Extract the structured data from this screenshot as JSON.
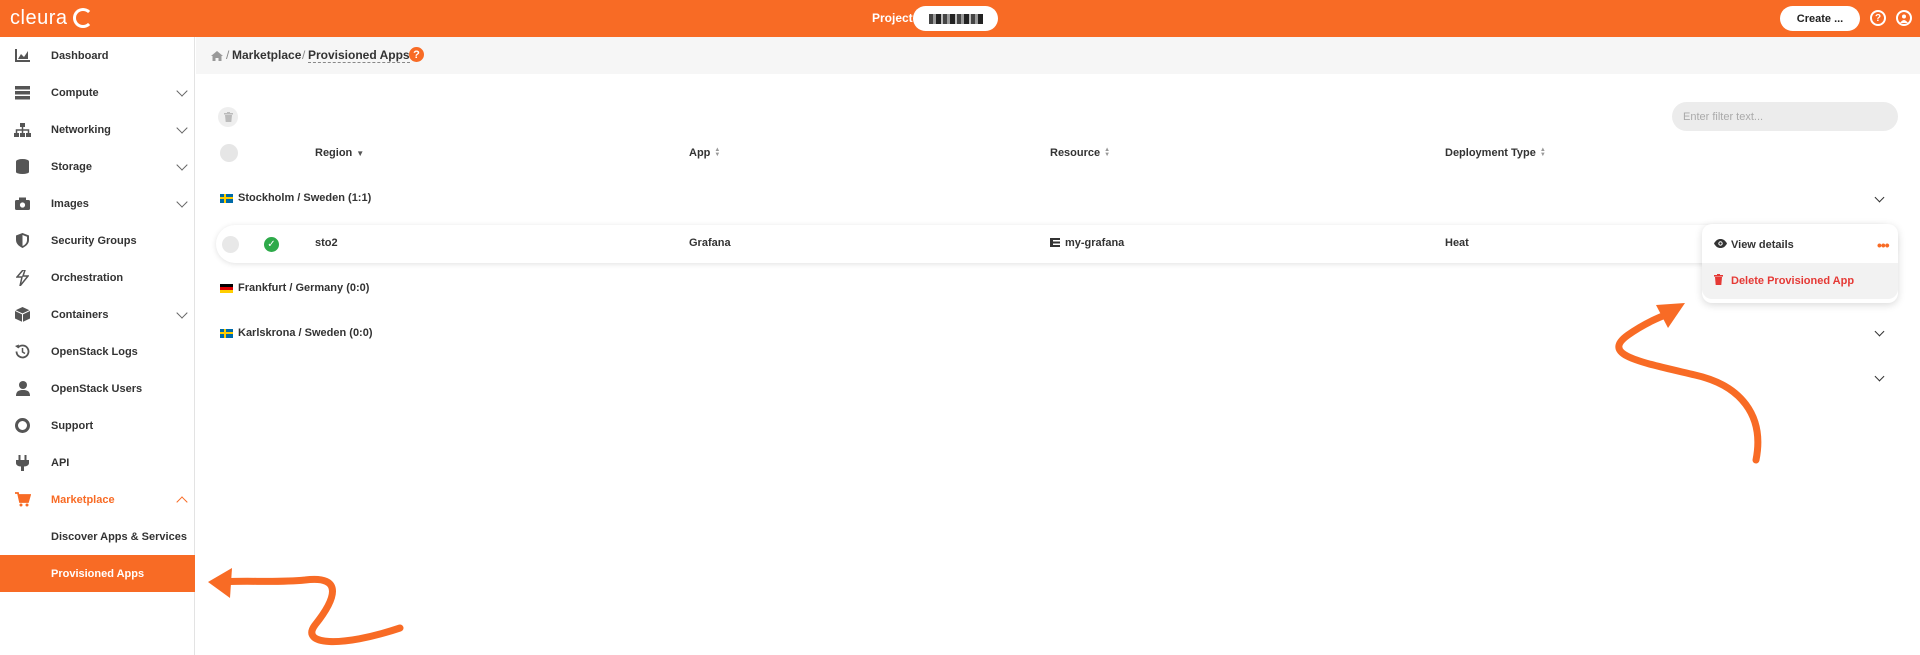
{
  "brand": {
    "name": "cleura"
  },
  "topbar": {
    "project_label": "Project",
    "create_label": "Create ...",
    "help_icon": "?"
  },
  "sidebar": {
    "items": [
      {
        "label": "Dashboard",
        "icon": "chart-icon"
      },
      {
        "label": "Compute",
        "icon": "server-icon"
      },
      {
        "label": "Networking",
        "icon": "network-icon"
      },
      {
        "label": "Storage",
        "icon": "database-icon"
      },
      {
        "label": "Images",
        "icon": "camera-icon"
      },
      {
        "label": "Security Groups",
        "icon": "shield-icon"
      },
      {
        "label": "Orchestration",
        "icon": "orchestration-icon"
      },
      {
        "label": "Containers",
        "icon": "cube-icon"
      },
      {
        "label": "OpenStack Logs",
        "icon": "history-icon"
      },
      {
        "label": "OpenStack Users",
        "icon": "user-icon"
      },
      {
        "label": "Support",
        "icon": "lifebuoy-icon"
      },
      {
        "label": "API",
        "icon": "plug-icon"
      },
      {
        "label": "Marketplace",
        "icon": "cart-icon"
      },
      {
        "label": "Discover Apps & Services"
      },
      {
        "label": "Provisioned Apps"
      }
    ]
  },
  "breadcrumb": {
    "sep": "/",
    "marketplace": "Marketplace",
    "current": "Provisioned Apps",
    "help": "?"
  },
  "filter": {
    "placeholder": "Enter filter text..."
  },
  "table": {
    "columns": {
      "region": "Region",
      "app": "App",
      "resource": "Resource",
      "deployment": "Deployment Type"
    },
    "groups": [
      {
        "label": "Stockholm / Sweden",
        "count": "(1:1)"
      },
      {
        "label": "Frankfurt / Germany",
        "count": "(0:0)"
      },
      {
        "label": "Karlskrona / Sweden",
        "count": "(0:0)"
      }
    ],
    "rows": [
      {
        "region": "sto2",
        "app": "Grafana",
        "resource": "my-grafana",
        "deployment": "Heat",
        "status": "✓"
      }
    ]
  },
  "menu": {
    "view_details": "View details",
    "delete": "Delete Provisioned App",
    "more": "•••"
  },
  "colors": {
    "accent": "#f86b25",
    "danger": "#e53935",
    "success": "#2eaa4a"
  }
}
